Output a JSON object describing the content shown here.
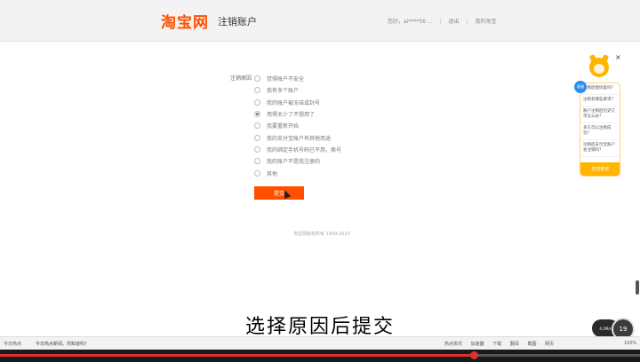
{
  "header": {
    "logo": "淘宝网",
    "title": "注销账户",
    "links": [
      "您好，ai****56 ...",
      "|",
      "退出",
      "|",
      "我的淘宝"
    ]
  },
  "form": {
    "reason_label": "注销原因",
    "options": [
      {
        "label": "觉得账户不安全",
        "checked": false
      },
      {
        "label": "我有多个账户",
        "checked": false
      },
      {
        "label": "我的账户被冻结或封号",
        "checked": false
      },
      {
        "label": "用得太少了不想用了",
        "checked": true
      },
      {
        "label": "我要重新开始",
        "checked": false
      },
      {
        "label": "我的支付宝账户有其他用途",
        "checked": false
      },
      {
        "label": "我的绑定手机号码已不用，换号",
        "checked": false
      },
      {
        "label": "我的账户不是我注册的",
        "checked": false
      },
      {
        "label": "其他",
        "checked": false
      }
    ],
    "submit_label": "提交"
  },
  "footer": {
    "copyright": "淘宝网版权所有 1999-2023"
  },
  "assistant": {
    "badge": "客服",
    "questions": [
      "注销后能恢复吗？",
      "注销有哪些要求？",
      "账户注销后历史订单怎么办？",
      "多久可以注销成功？",
      "注销后支付宝账户会注销吗？"
    ],
    "button": "在线咨询",
    "close": "×"
  },
  "overlay": {
    "subtitle": "选择原因后提交",
    "float_text": "4.2M/s",
    "float_circle": "19"
  },
  "statusbar": {
    "left": "今日热点",
    "news": "今日热点新闻，你知道吗？",
    "right_items": [
      "热点资讯",
      "加速器",
      "下载",
      "翻译",
      "截图",
      "网页"
    ],
    "zoom": "100%"
  },
  "video": {
    "progress": 0.74
  },
  "colors": {
    "brand": "#ff5000",
    "assistant": "#ffb400",
    "progress": "#e0302e"
  }
}
